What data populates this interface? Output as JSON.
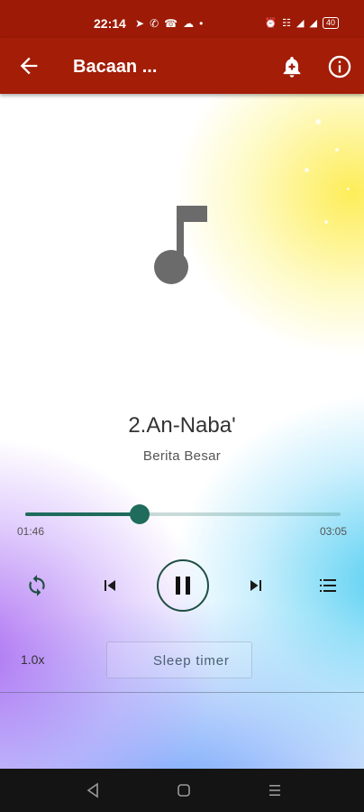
{
  "status_bar": {
    "time": "22:14",
    "notification_icons": [
      "telegram-icon",
      "whatsapp-icon",
      "whatsapp-business-icon",
      "cloud-icon",
      "dot-icon"
    ],
    "system_icons": [
      "alarm-icon",
      "vowifi-icon",
      "signal-icon",
      "signal-icon"
    ],
    "battery": "40"
  },
  "app_bar": {
    "title": "Bacaan  ...",
    "background_color": "#a31d07"
  },
  "player": {
    "track_title": "2.An-Naba'",
    "track_subtitle": "Berita Besar",
    "current_time": "01:46",
    "total_time": "03:05",
    "progress": 0.364,
    "accent_color": "#1f6b5c",
    "speed_label": "1.0x",
    "sleep_timer_label": "Sleep timer",
    "is_playing": true
  },
  "nav_bar": {
    "buttons": [
      "back-icon",
      "home-icon",
      "recents-icon"
    ]
  }
}
